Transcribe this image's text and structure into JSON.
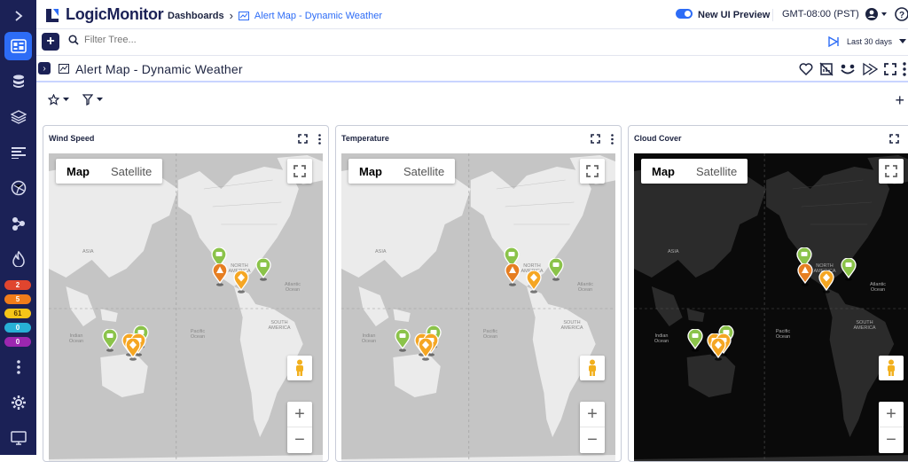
{
  "app": {
    "brand": "LogicMonitor"
  },
  "breadcrumb": {
    "root": "Dashboards",
    "current": "Alert Map - Dynamic Weather"
  },
  "header": {
    "new_ui_label": "New UI Preview",
    "timezone": "GMT-08:00 (PST)"
  },
  "subbar": {
    "filter_placeholder": "Filter Tree...",
    "time_range": "Last 30 days"
  },
  "dashboard": {
    "title": "Alert Map - Dynamic Weather"
  },
  "sidebar": {
    "badges": [
      {
        "value": "2",
        "color": "#e0452e"
      },
      {
        "value": "5",
        "color": "#f07c1a"
      },
      {
        "value": "61",
        "color": "#f5c518"
      },
      {
        "value": "0",
        "color": "#27b0d6"
      },
      {
        "value": "0",
        "color": "#9c27b0"
      }
    ]
  },
  "map_controls": {
    "map_label": "Map",
    "satellite_label": "Satellite",
    "zoom_in": "+",
    "zoom_out": "−"
  },
  "map_labels": {
    "asia": "ASIA",
    "north_america": "NORTH AMERICA",
    "south_america": "SOUTH AMERICA",
    "atlantic": "Atlantic Ocean",
    "pacific": "Pacific Ocean",
    "indian": "Indian Ocean"
  },
  "widgets": [
    {
      "title": "Wind Speed",
      "theme": "light"
    },
    {
      "title": "Temperature",
      "theme": "light"
    },
    {
      "title": "Cloud Cover",
      "theme": "dark"
    }
  ],
  "colors": {
    "accent": "#2d6cf6",
    "nav": "#1b2156",
    "marker_green": "#8bc34a",
    "marker_orange": "#f5a623",
    "marker_dark_orange": "#e67e22"
  }
}
